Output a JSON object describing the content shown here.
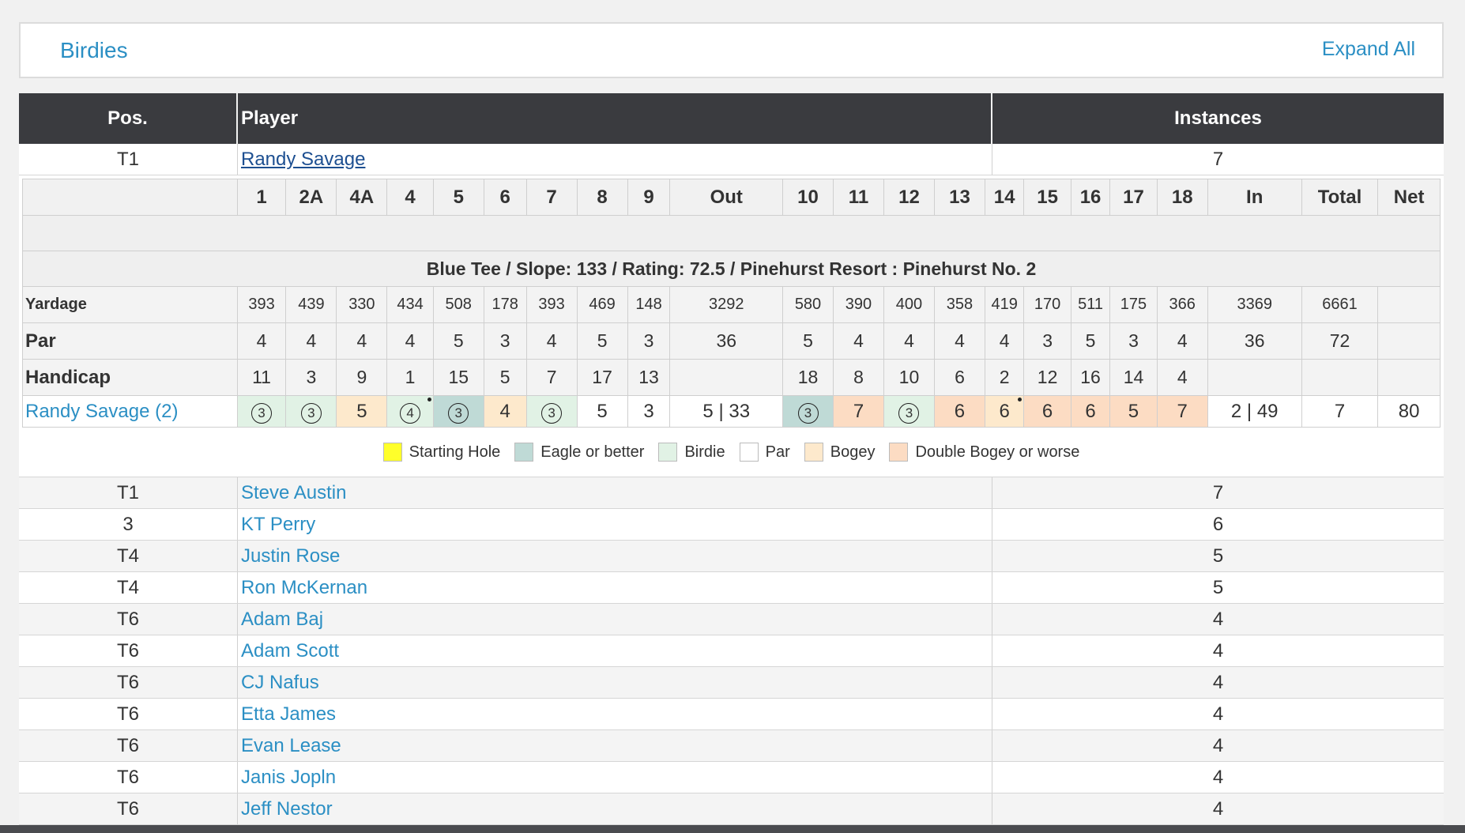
{
  "panel": {
    "title": "Birdies",
    "expand_label": "Expand All"
  },
  "table": {
    "headers": {
      "pos": "Pos.",
      "player": "Player",
      "instances": "Instances"
    },
    "leader": {
      "pos": "T1",
      "name": "Randy Savage",
      "instances": "7"
    },
    "rows": [
      {
        "pos": "T1",
        "name": "Steve Austin",
        "instances": "7"
      },
      {
        "pos": "3",
        "name": "KT Perry",
        "instances": "6"
      },
      {
        "pos": "T4",
        "name": "Justin Rose",
        "instances": "5"
      },
      {
        "pos": "T4",
        "name": "Ron McKernan",
        "instances": "5"
      },
      {
        "pos": "T6",
        "name": "Adam Baj",
        "instances": "4"
      },
      {
        "pos": "T6",
        "name": "Adam Scott",
        "instances": "4"
      },
      {
        "pos": "T6",
        "name": "CJ Nafus",
        "instances": "4"
      },
      {
        "pos": "T6",
        "name": "Etta James",
        "instances": "4"
      },
      {
        "pos": "T6",
        "name": "Evan Lease",
        "instances": "4"
      },
      {
        "pos": "T6",
        "name": "Janis Jopln",
        "instances": "4"
      },
      {
        "pos": "T6",
        "name": "Jeff Nestor",
        "instances": "4"
      }
    ]
  },
  "scorecard": {
    "columns": [
      "1",
      "2A",
      "4A",
      "4",
      "5",
      "6",
      "7",
      "8",
      "9",
      "Out",
      "10",
      "11",
      "12",
      "13",
      "14",
      "15",
      "16",
      "17",
      "18",
      "In",
      "Total",
      "Net"
    ],
    "tee_info": "Blue Tee / Slope: 133 / Rating: 72.5 / Pinehurst Resort : Pinehurst No. 2",
    "yardage": {
      "label": "Yardage",
      "values": [
        "393",
        "439",
        "330",
        "434",
        "508",
        "178",
        "393",
        "469",
        "148",
        "3292",
        "580",
        "390",
        "400",
        "358",
        "419",
        "170",
        "511",
        "175",
        "366",
        "3369",
        "6661",
        ""
      ]
    },
    "par": {
      "label": "Par",
      "values": [
        "4",
        "4",
        "4",
        "4",
        "5",
        "3",
        "4",
        "5",
        "3",
        "36",
        "5",
        "4",
        "4",
        "4",
        "4",
        "3",
        "5",
        "3",
        "4",
        "36",
        "72",
        ""
      ]
    },
    "handicap": {
      "label": "Handicap",
      "values": [
        "11",
        "3",
        "9",
        "1",
        "15",
        "5",
        "7",
        "17",
        "13",
        "",
        "18",
        "8",
        "10",
        "6",
        "2",
        "12",
        "16",
        "14",
        "4",
        "",
        "",
        ""
      ]
    },
    "player": {
      "label": "Randy Savage (2)",
      "scores": [
        {
          "v": "3",
          "s": "birdie",
          "circle": true
        },
        {
          "v": "3",
          "s": "birdie",
          "circle": true
        },
        {
          "v": "5",
          "s": "bogey"
        },
        {
          "v": "4",
          "s": "birdie",
          "circle": true,
          "dot": true
        },
        {
          "v": "3",
          "s": "eagle",
          "circle": true
        },
        {
          "v": "4",
          "s": "bogey"
        },
        {
          "v": "3",
          "s": "birdie",
          "circle": true
        },
        {
          "v": "5",
          "s": "par"
        },
        {
          "v": "3",
          "s": "par"
        },
        {
          "v": "5 | 33",
          "s": "total"
        },
        {
          "v": "3",
          "s": "eagle",
          "circle": true
        },
        {
          "v": "7",
          "s": "dbl"
        },
        {
          "v": "3",
          "s": "birdie",
          "circle": true
        },
        {
          "v": "6",
          "s": "dbl"
        },
        {
          "v": "6",
          "s": "bogey",
          "dot": true
        },
        {
          "v": "6",
          "s": "dbl"
        },
        {
          "v": "6",
          "s": "dbl"
        },
        {
          "v": "5",
          "s": "dbl"
        },
        {
          "v": "7",
          "s": "dbl"
        },
        {
          "v": "2 | 49",
          "s": "total"
        },
        {
          "v": "7",
          "s": "total"
        },
        {
          "v": "80",
          "s": "total"
        }
      ]
    },
    "legend": [
      {
        "label": "Starting Hole",
        "color": "#ffff2a"
      },
      {
        "label": "Eagle or better",
        "color": "#bfdad6"
      },
      {
        "label": "Birdie",
        "color": "#e1f2e5"
      },
      {
        "label": "Par",
        "color": "#ffffff"
      },
      {
        "label": "Bogey",
        "color": "#fde9cc"
      },
      {
        "label": "Double Bogey or worse",
        "color": "#fcdcc3"
      }
    ]
  }
}
